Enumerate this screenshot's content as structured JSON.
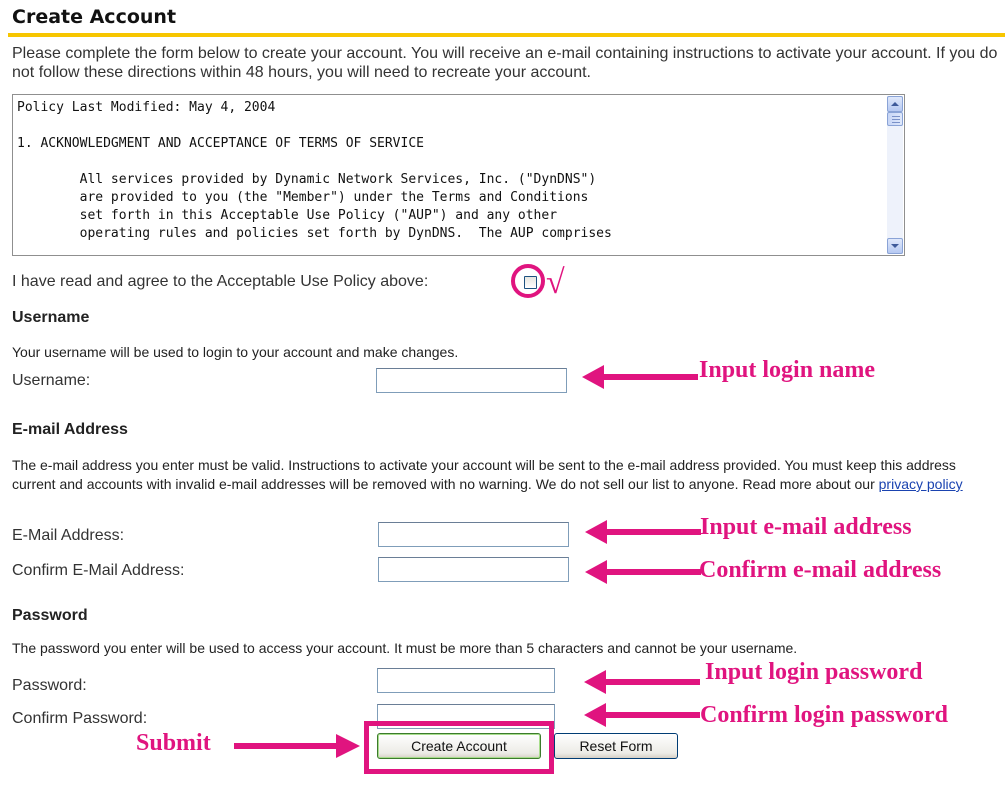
{
  "page": {
    "title": "Create Account",
    "intro": "Please complete the form below to create your account. You will receive an e-mail containing instructions to activate your account. If you do not follow these directions within 48 hours, you will need to recreate your account."
  },
  "policy": {
    "lines": [
      "Policy Last Modified: May 4, 2004",
      "",
      "1. ACKNOWLEDGMENT AND ACCEPTANCE OF TERMS OF SERVICE",
      "",
      "        All services provided by Dynamic Network Services, Inc. (\"DynDNS\")",
      "        are provided to you (the \"Member\") under the Terms and Conditions",
      "        set forth in this Acceptable Use Policy (\"AUP\") and any other",
      "        operating rules and policies set forth by DynDNS.  The AUP comprises"
    ],
    "agree_label": "I have read and agree to the Acceptable Use Policy above:",
    "agree_checked": false,
    "check_mark": "√"
  },
  "username": {
    "heading": "Username",
    "description": "Your username will be used to login to your account and make changes.",
    "label": "Username:",
    "value": ""
  },
  "email": {
    "heading": "E-mail Address",
    "description": "The e-mail address you enter must be valid. Instructions to activate your account will be sent to the e-mail address provided. You must keep this address current and accounts with invalid e-mail addresses will be removed with no warning. We do not sell our list to anyone. Read more about our",
    "privacy_link": "privacy policy",
    "label": "E-Mail Address:",
    "confirm_label": "Confirm E-Mail Address:",
    "value": "",
    "confirm_value": ""
  },
  "password": {
    "heading": "Password",
    "description": "The password you enter will be used to access your account. It must be more than 5 characters and cannot be your username.",
    "label": "Password:",
    "confirm_label": "Confirm Password:",
    "value": "",
    "confirm_value": ""
  },
  "buttons": {
    "create": "Create Account",
    "reset": "Reset Form"
  },
  "annotations": {
    "login_name": "Input login name",
    "email": "Input e-mail address",
    "confirm_email": "Confirm e-mail address",
    "password": "Input login password",
    "confirm_password": "Confirm login password",
    "submit": "Submit"
  },
  "colors": {
    "accent": "#f7c600",
    "annotation": "#e0147f",
    "link": "#1a43b0"
  }
}
